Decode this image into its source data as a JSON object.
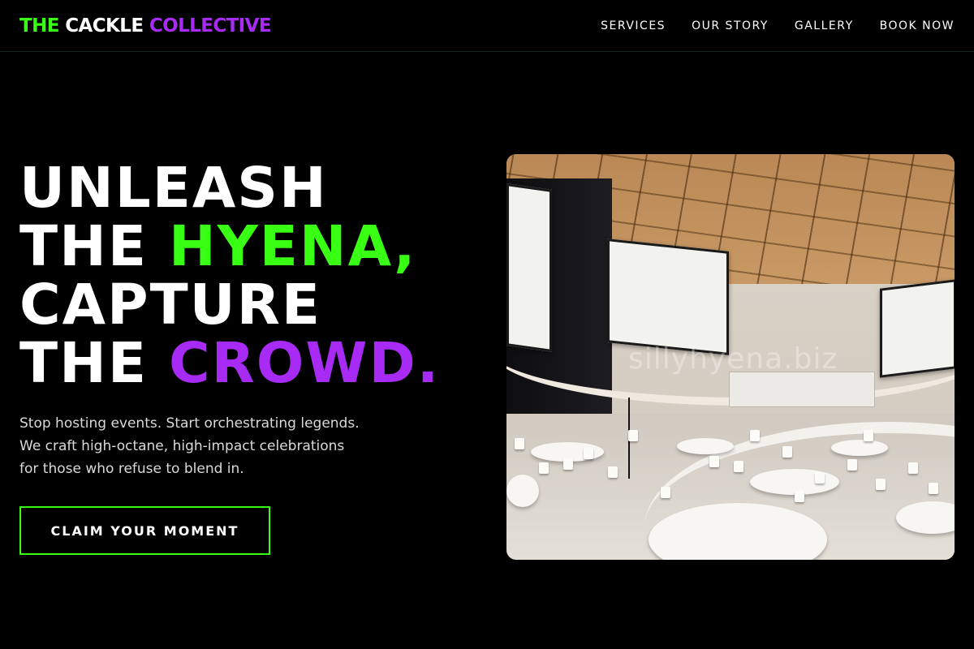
{
  "header": {
    "logo": {
      "word1": "THE",
      "word2": "CACKLE",
      "word3": "COLLECTIVE"
    },
    "nav": [
      "SERVICES",
      "OUR STORY",
      "GALLERY",
      "BOOK NOW"
    ]
  },
  "hero": {
    "heading": {
      "line1": "UNLEASH",
      "line2_prefix": "THE ",
      "line2_accent": "HYENA,",
      "line3": "CAPTURE",
      "line4_prefix": "THE ",
      "line4_accent": "CROWD."
    },
    "copy": [
      "Stop hosting events. Start orchestrating legends.",
      "We craft high-octane, high-impact celebrations",
      "for those who refuse to blend in."
    ],
    "cta_label": "CLAIM YOUR MOMENT",
    "image": {
      "subject": "conference-hall-photo",
      "watermark": "sillyhyena.biz"
    }
  },
  "colors": {
    "background": "#000000",
    "accent_green": "#39ff14",
    "accent_purple": "#a72bf5",
    "text": "#ffffff",
    "body_text": "#d9d9d9"
  }
}
